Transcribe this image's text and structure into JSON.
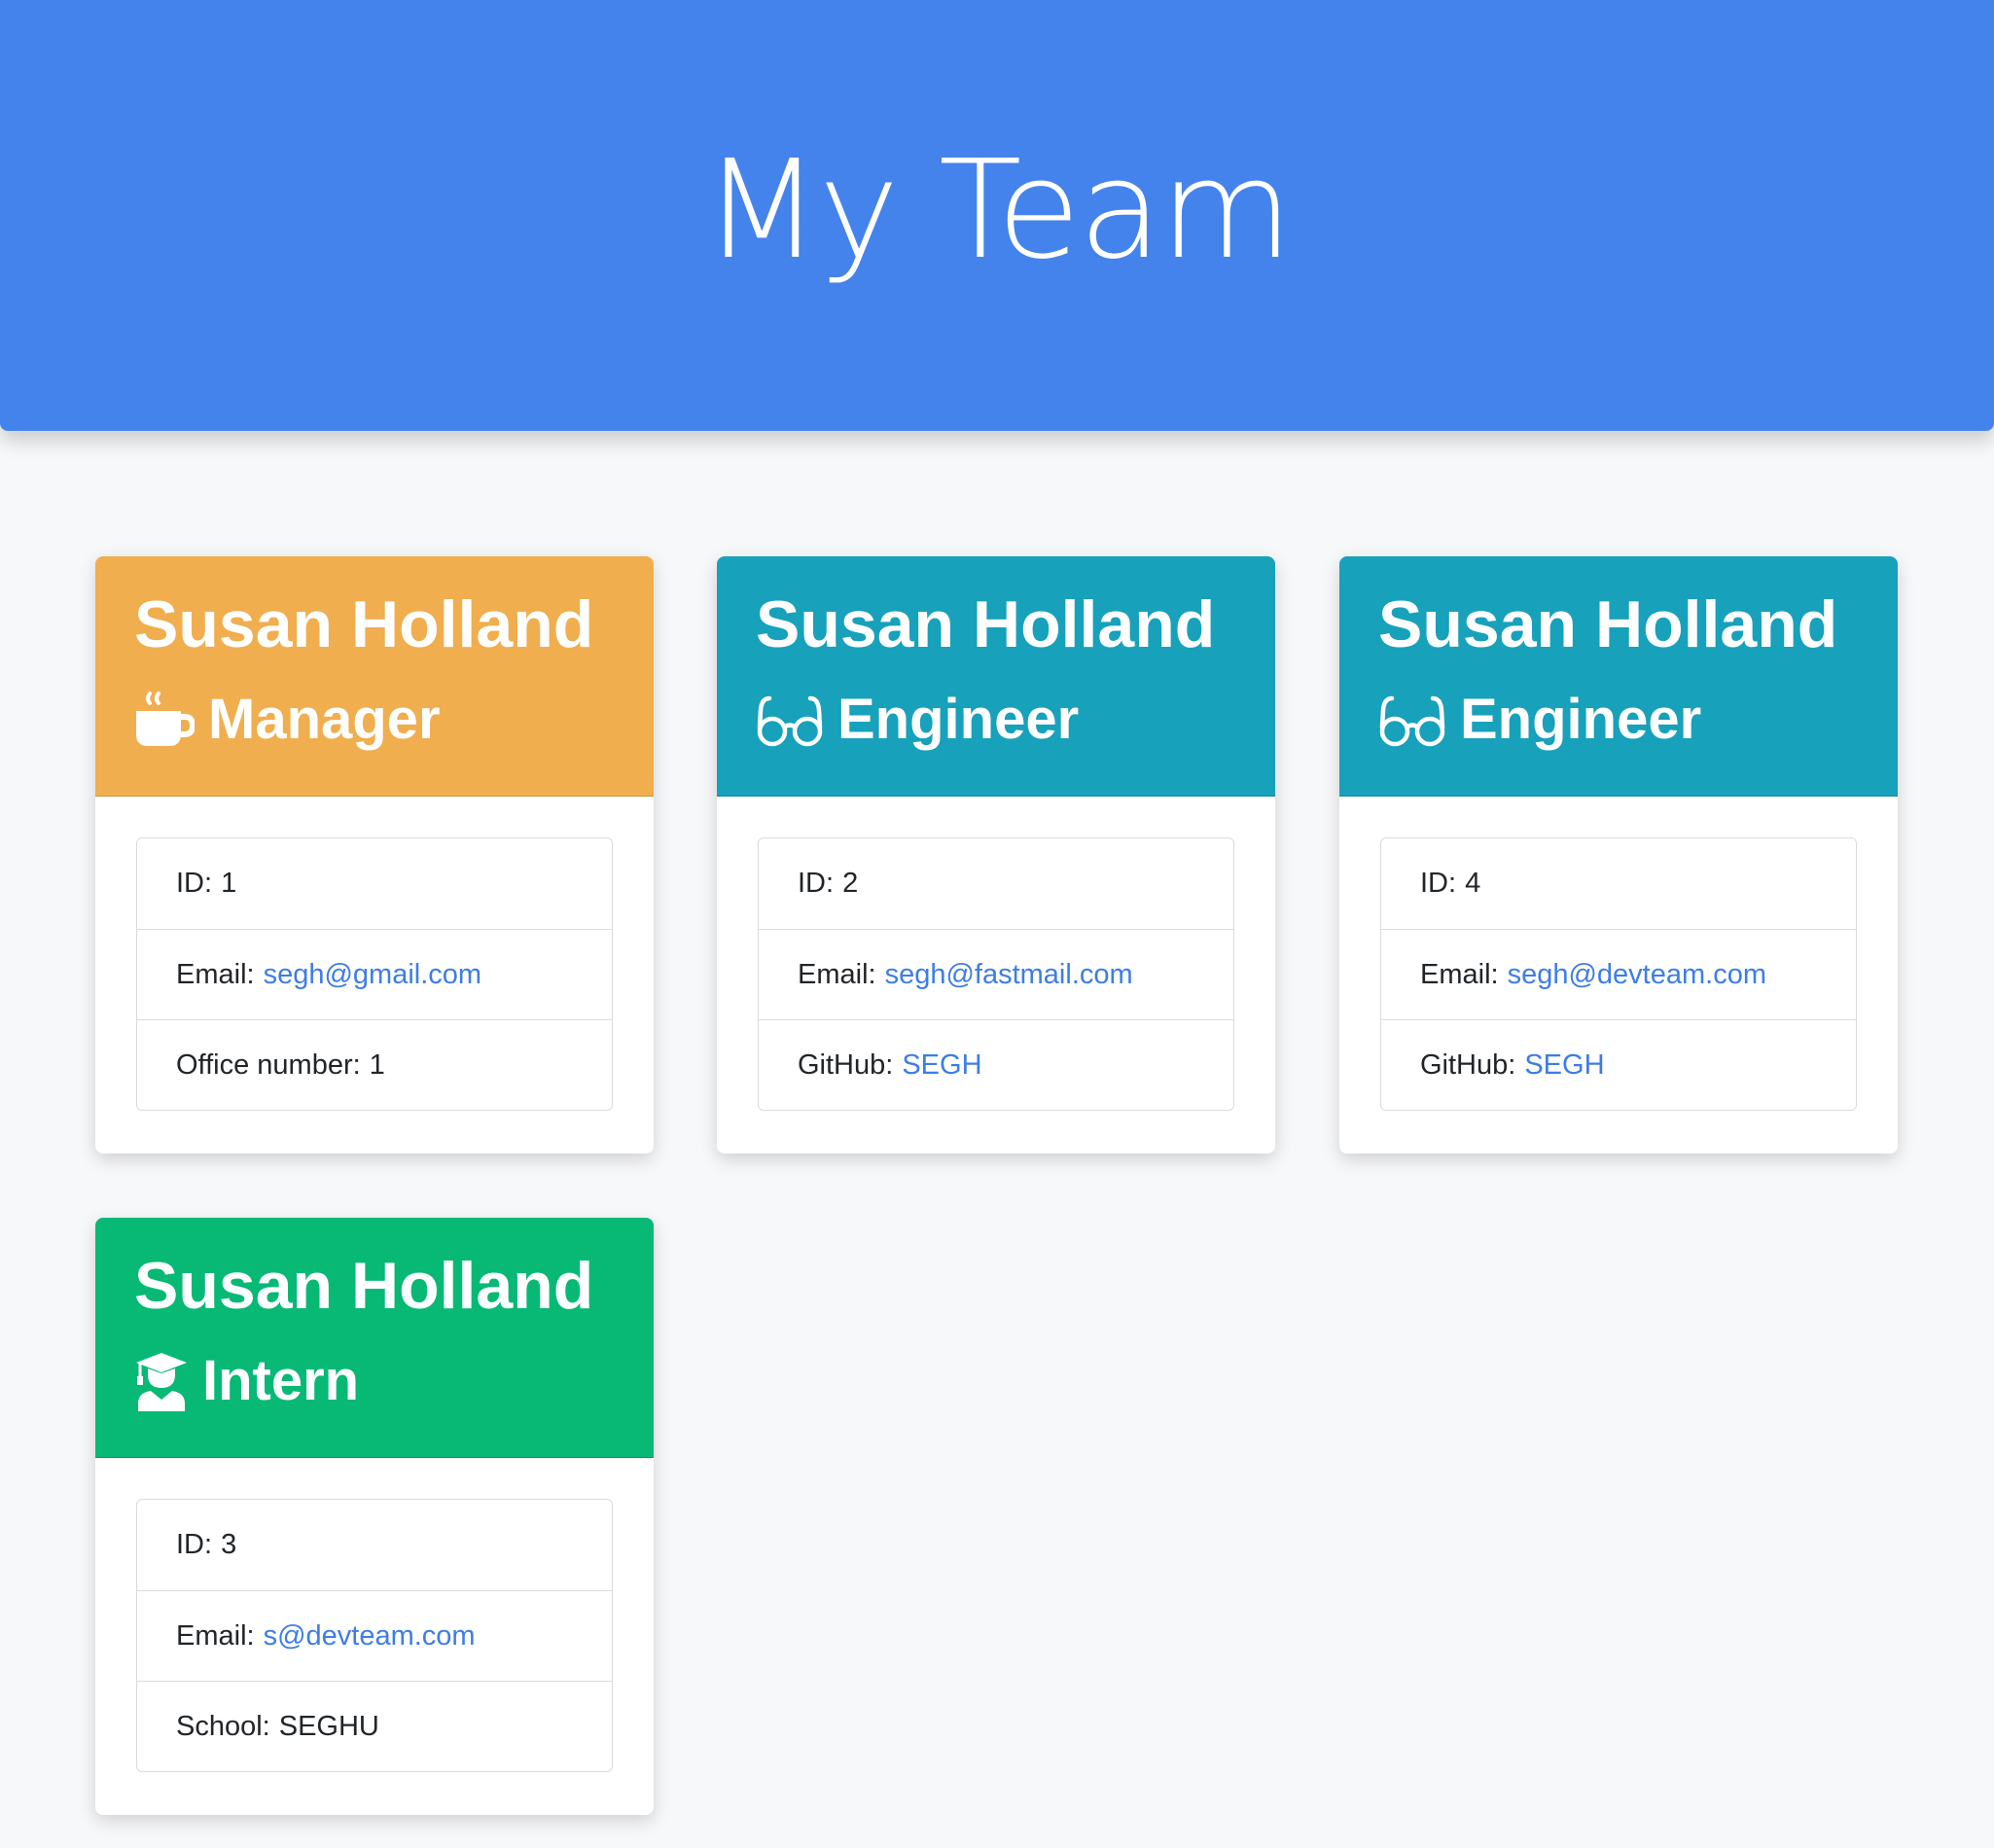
{
  "header": {
    "title": "My Team"
  },
  "colors": {
    "header": "#4583ec",
    "manager": "#f0ae4f",
    "engineer": "#17a1bb",
    "intern": "#07b975",
    "link": "#3d7de6"
  },
  "cards": [
    {
      "name": "Susan Holland",
      "role": "Manager",
      "icon": "coffee-mug-icon",
      "id_label": "ID:",
      "id_value": "1",
      "email_label": "Email:",
      "email_value": "segh@gmail.com",
      "extra_label": "Office number:",
      "extra_value": "1"
    },
    {
      "name": "Susan Holland",
      "role": "Engineer",
      "icon": "glasses-icon",
      "id_label": "ID:",
      "id_value": "2",
      "email_label": "Email:",
      "email_value": "segh@fastmail.com",
      "extra_label": "GitHub:",
      "extra_value": "SEGH"
    },
    {
      "name": "Susan Holland",
      "role": "Engineer",
      "icon": "glasses-icon",
      "id_label": "ID:",
      "id_value": "4",
      "email_label": "Email:",
      "email_value": "segh@devteam.com",
      "extra_label": "GitHub:",
      "extra_value": "SEGH"
    },
    {
      "name": "Susan Holland",
      "role": "Intern",
      "icon": "graduate-icon",
      "id_label": "ID:",
      "id_value": "3",
      "email_label": "Email:",
      "email_value": "s@devteam.com",
      "extra_label": "School:",
      "extra_value": "SEGHU"
    }
  ]
}
